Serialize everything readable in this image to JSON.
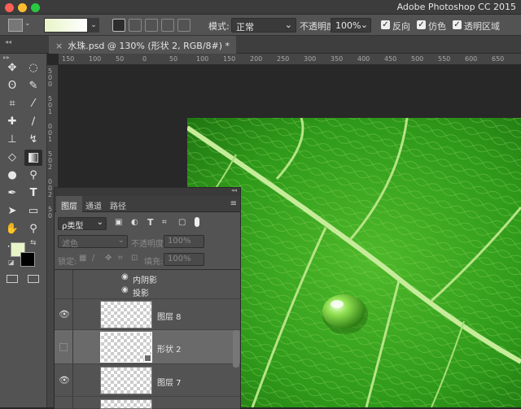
{
  "app": {
    "title": "Adobe Photoshop CC 2015"
  },
  "options": {
    "mode_label": "模式:",
    "mode_value": "正常",
    "opacity_label": "不透明度:",
    "opacity_value": "100%",
    "reverse_label": "反向",
    "dither_label": "仿色",
    "transparency_label": "透明区域"
  },
  "document": {
    "tab_title": "水珠.psd @ 130% (形状 2, RGB/8#) *",
    "close_glyph": "×"
  },
  "ruler": {
    "h_ticks": [
      "150",
      "100",
      "50",
      "0",
      "50",
      "100",
      "150",
      "200",
      "250",
      "300",
      "350",
      "400",
      "450",
      "500",
      "550",
      "600",
      "650"
    ],
    "v_ticks": [
      "5",
      "0",
      "0",
      "5",
      "0",
      "1",
      "0",
      "0",
      "1",
      "5",
      "0",
      "2",
      "0",
      "0",
      "2",
      "5",
      "0"
    ]
  },
  "layers_panel": {
    "tabs": [
      "图层",
      "通道",
      "路径"
    ],
    "filter_label": "ρ类型",
    "blend_mode": "滤色",
    "opacity_label": "不透明度:",
    "opacity_value": "100%",
    "lock_label": "锁定:",
    "fill_label": "填充:",
    "fill_value": "100%",
    "effects": [
      "内阴影",
      "投影"
    ],
    "layers": [
      {
        "name": "图层 8",
        "visible": true
      },
      {
        "name": "形状 2",
        "visible": false,
        "selected": true
      },
      {
        "name": "图层 7",
        "visible": true
      }
    ]
  },
  "colors": {
    "accent": "#2d2d2d",
    "foreground": "#e8f5c8",
    "background": "#000000"
  }
}
